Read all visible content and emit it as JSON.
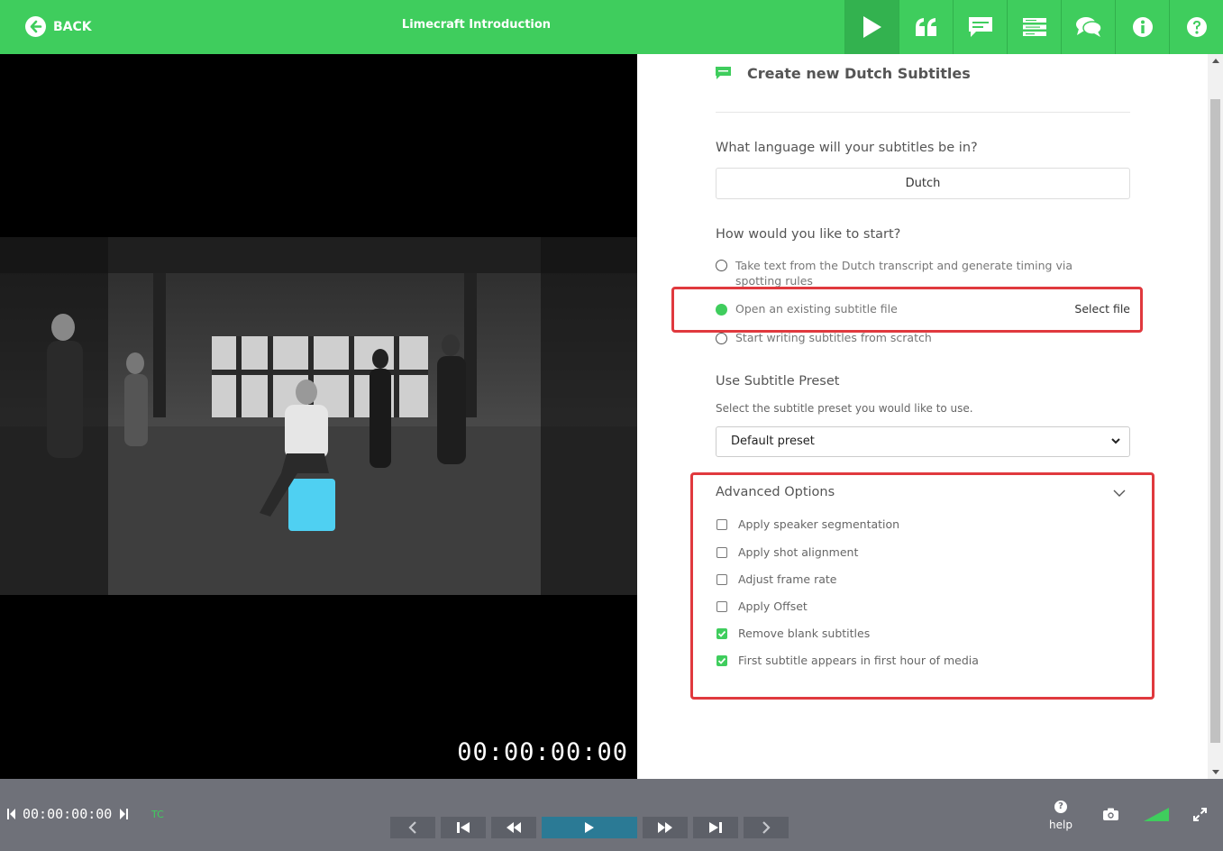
{
  "header": {
    "back_label": "BACK",
    "title": "Limecraft Introduction",
    "icons": [
      "play-icon",
      "quote-icon",
      "subtitle-icon",
      "list-icon",
      "comments-icon",
      "info-icon",
      "help-icon"
    ]
  },
  "video": {
    "timecode": "00:00:00:00"
  },
  "panel": {
    "heading": "Create new Dutch Subtitles",
    "language_question": "What language will your subtitles be in?",
    "language_value": "Dutch",
    "start_question": "How would you like to start?",
    "start_options": [
      {
        "label": "Take text from the Dutch transcript and generate timing via spotting rules",
        "selected": false
      },
      {
        "label": "Open an existing subtitle file",
        "selected": true,
        "action": "Select file"
      },
      {
        "label": "Start writing subtitles from scratch",
        "selected": false
      }
    ],
    "preset_title": "Use Subtitle Preset",
    "preset_hint": "Select the subtitle preset you would like to use.",
    "preset_value": "Default preset",
    "advanced_title": "Advanced Options",
    "advanced_options": [
      {
        "label": "Apply speaker segmentation",
        "checked": false
      },
      {
        "label": "Apply shot alignment",
        "checked": false
      },
      {
        "label": "Adjust frame rate",
        "checked": false
      },
      {
        "label": "Apply Offset",
        "checked": false
      },
      {
        "label": "Remove blank subtitles",
        "checked": true
      },
      {
        "label": "First subtitle appears in first hour of media",
        "checked": true
      }
    ]
  },
  "player": {
    "timecode": "00:00:00:00",
    "tc_label": "TC",
    "help_label": "help"
  },
  "colors": {
    "brand_green": "#3fcd5d",
    "highlight_red": "#e0393e",
    "player_bar": "#6f7179",
    "play_button": "#2b7a95"
  }
}
